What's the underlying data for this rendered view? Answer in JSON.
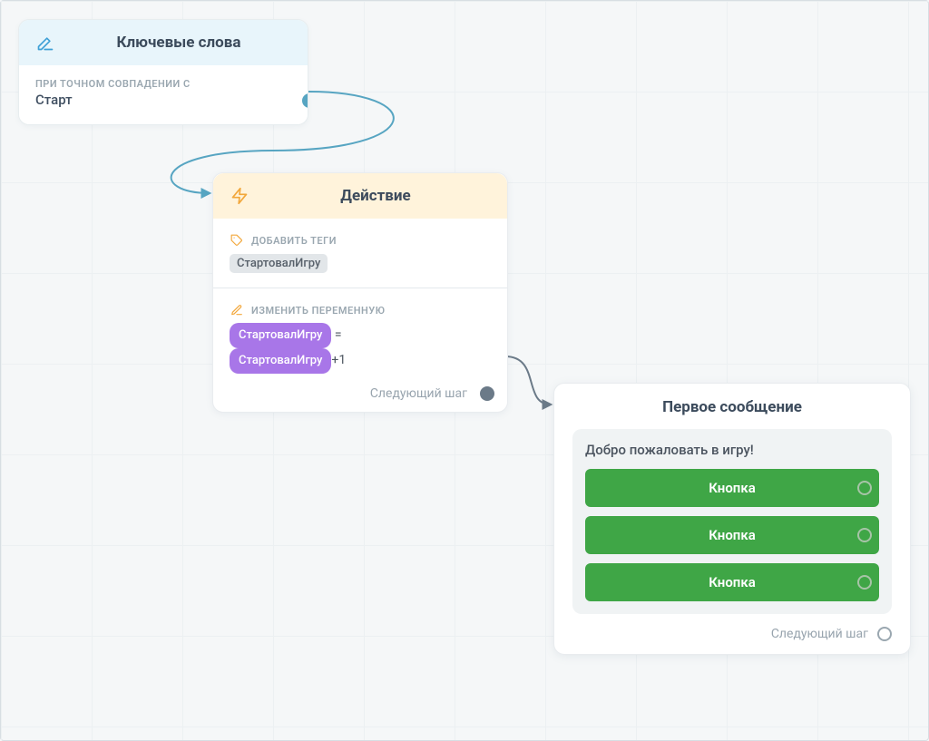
{
  "keywords_node": {
    "title": "Ключевые слова",
    "match_label": "ПРИ ТОЧНОМ СОВПАДЕНИИ С",
    "value": "Старт"
  },
  "action_node": {
    "title": "Действие",
    "tags": {
      "label": "ДОБАВИТЬ ТЕГИ",
      "value": "СтартовалИгру"
    },
    "variable": {
      "label": "ИЗМЕНИТЬ ПЕРЕМЕННУЮ",
      "var_name": "СтартовалИгру",
      "equals": " = ",
      "rhs_var": "СтартовалИгру",
      "rhs_suffix": "+1"
    },
    "next_step_label": "Следующий шаг"
  },
  "message_node": {
    "title": "Первое сообщение",
    "welcome_text": "Добро пожаловать в игру!",
    "buttons": [
      {
        "label": "Кнопка"
      },
      {
        "label": "Кнопка"
      },
      {
        "label": "Кнопка"
      }
    ],
    "next_step_label": "Следующий шаг"
  },
  "colors": {
    "accent_blue": "#57a5c2",
    "accent_yellow_bg": "#fff3db",
    "accent_button_green": "#3fa646",
    "pill_purple": "#a876e8"
  }
}
